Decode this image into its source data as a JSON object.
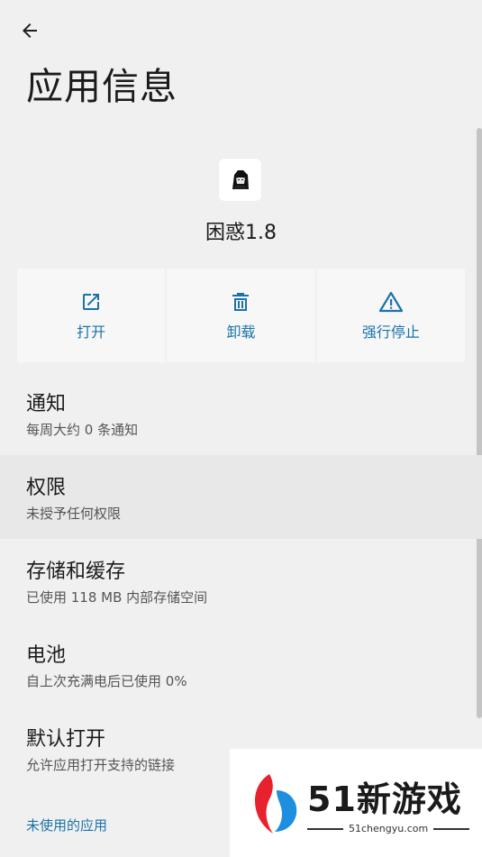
{
  "header": {
    "back_icon": "arrow-left-icon",
    "title": "应用信息"
  },
  "app": {
    "name": "困惑1.8",
    "icon": "app-icon-anime-character"
  },
  "actions": [
    {
      "label": "打开",
      "icon": "open-external-icon"
    },
    {
      "label": "卸载",
      "icon": "trash-icon"
    },
    {
      "label": "强行停止",
      "icon": "warning-triangle-icon"
    }
  ],
  "settings": [
    {
      "title": "通知",
      "subtitle": "每周大约 0 条通知"
    },
    {
      "title": "权限",
      "subtitle": "未授予任何权限"
    },
    {
      "title": "存储和缓存",
      "subtitle": "已使用 118 MB 内部存储空间"
    },
    {
      "title": "电池",
      "subtitle": "自上次充满电后已使用 0%"
    },
    {
      "title": "默认打开",
      "subtitle": "允许应用打开支持的链接"
    }
  ],
  "unused_apps_label": "未使用的应用",
  "watermark": {
    "brand": "51新游戏",
    "url": "51chengyu.com"
  },
  "colors": {
    "background": "#f0f0f1",
    "accent": "#1a73a8",
    "highlight_row": "#e8e8e9"
  }
}
